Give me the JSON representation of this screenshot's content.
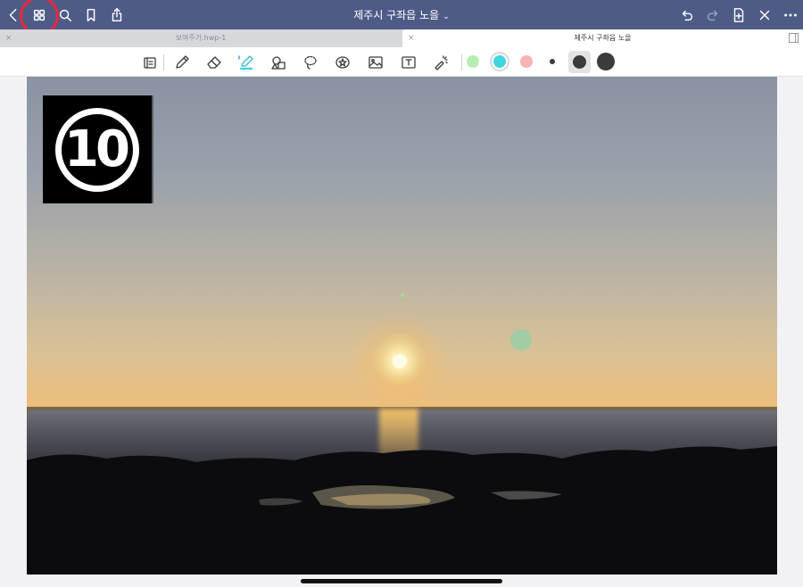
{
  "app": {
    "title": "제주시 구좌읍 노을",
    "title_chevron": "⌄"
  },
  "tabs": [
    {
      "label": "보여주기.hwp-1",
      "close": "×",
      "active": false
    },
    {
      "label": "제주시 구좌읍 노을",
      "close": "×",
      "active": true
    }
  ],
  "navbar": {
    "left_icons": [
      "back-chevron-icon",
      "grid-view-icon",
      "search-icon",
      "bookmark-icon",
      "share-icon"
    ],
    "right_icons": [
      "undo-icon",
      "redo-icon",
      "add-page-icon",
      "close-icon",
      "more-icon"
    ]
  },
  "toolbar": {
    "tools": [
      "page-view-icon",
      "pen-icon",
      "eraser-icon",
      "highlighter-icon",
      "shapes-icon",
      "lasso-icon",
      "sticker-icon",
      "image-icon",
      "text-box-icon",
      "laser-pointer-icon"
    ],
    "selected_tool": "highlighter-icon",
    "colors": [
      "#b4efb1",
      "#3fd6e0",
      "#f6b3b3"
    ],
    "selected_color": "#3fd6e0",
    "stroke_widths": [
      "small",
      "medium",
      "large",
      "xlarge"
    ],
    "selected_width": "large",
    "width_color": "#3b3b3b"
  },
  "canvas": {
    "logo_text": "10"
  },
  "colors": {
    "navbar": "#4f5b87",
    "highlight_ring": "#e8283f"
  }
}
